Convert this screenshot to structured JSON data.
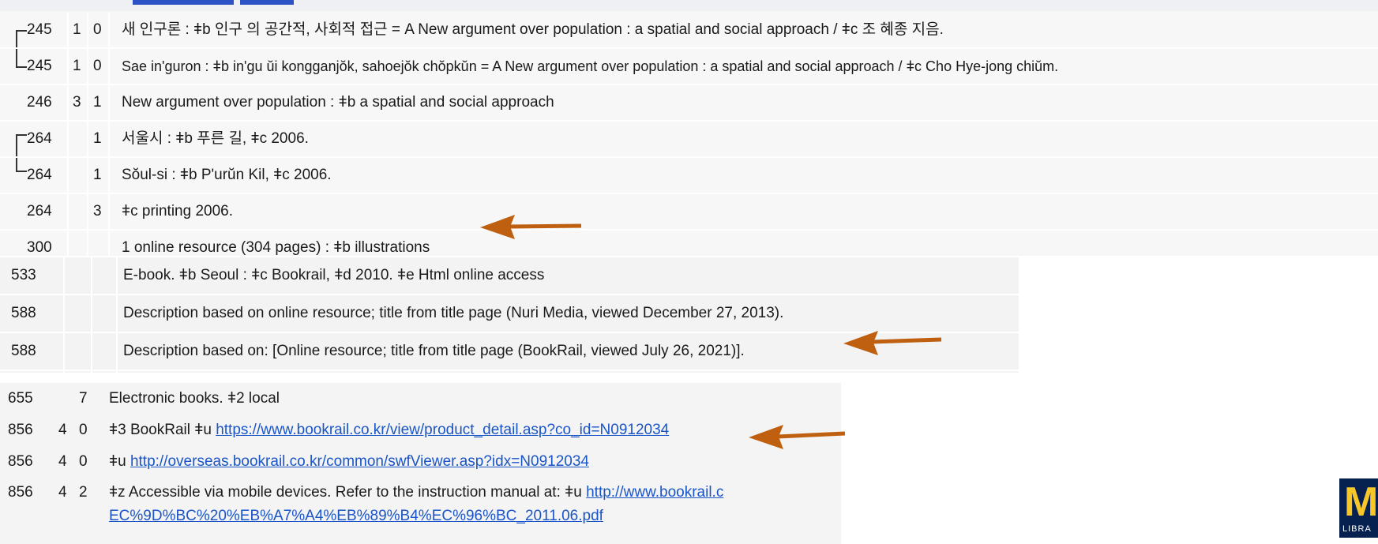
{
  "panel_a": {
    "rows": [
      {
        "tag": "245",
        "ind1": "1",
        "ind2": "0",
        "content": "새 인구론 : ǂb 인구 의 공간적, 사회적 접근 = A New argument over population : a spatial and social approach / ǂc 조 혜종 지음."
      },
      {
        "tag": "245",
        "ind1": "1",
        "ind2": "0",
        "content": "Sae in'guron : ǂb in'gu ŭi kongganjŏk, sahoejŏk chŏpkŭn = A New argument over population : a spatial and social approach / ǂc Cho Hye-jong chiŭm."
      },
      {
        "tag": "246",
        "ind1": "3",
        "ind2": "1",
        "content": "New argument over population : ǂb a spatial and social approach"
      },
      {
        "tag": "264",
        "ind1": "",
        "ind2": "1",
        "content": "서울시 : ǂb 푸른 길, ǂc 2006."
      },
      {
        "tag": "264",
        "ind1": "",
        "ind2": "1",
        "content": "Sŏul-si : ǂb P'urŭn Kil, ǂc 2006."
      },
      {
        "tag": "264",
        "ind1": "",
        "ind2": "3",
        "content": "ǂc printing 2006."
      },
      {
        "tag": "300",
        "ind1": "",
        "ind2": "",
        "content": "1 online resource (304 pages) : ǂb illustrations"
      }
    ]
  },
  "panel_b": {
    "rows": [
      {
        "tag": "533",
        "content": "E-book. ǂb Seoul : ǂc Bookrail, ǂd 2010. ǂe Html online access"
      },
      {
        "tag": "588",
        "content": "Description based on online resource; title from title page (Nuri Media, viewed December 27, 2013)."
      },
      {
        "tag": "588",
        "content": "Description based on: [Online resource; title from title page (BookRail, viewed July 26, 2021)]."
      }
    ]
  },
  "panel_c": {
    "rows": [
      {
        "tag": "655",
        "ind1": "",
        "ind2": "7",
        "prefix": "ǂ2 local",
        "content": "Electronic books."
      },
      {
        "tag": "856",
        "ind1": "4",
        "ind2": "0",
        "prefix": "ǂ3 BookRail ǂu",
        "link": "https://www.bookrail.co.kr/view/product_detail.asp?co_id=N0912034"
      },
      {
        "tag": "856",
        "ind1": "4",
        "ind2": "0",
        "prefix": "ǂu",
        "link": "http://overseas.bookrail.co.kr/common/swfViewer.asp?idx=N0912034"
      },
      {
        "tag": "856",
        "ind1": "4",
        "ind2": "2",
        "prefix": "ǂz Accessible via mobile devices. Refer to the instruction manual at: ǂu",
        "link": "http://www.bookrail.c",
        "link_line2": "EC%9D%BC%20%EB%A7%A4%EB%89%B4%EC%96%BC_2011.06.pdf"
      }
    ]
  },
  "logo": {
    "letter": "M",
    "caption": "LIBRA"
  },
  "colors": {
    "arrow": "#bf5f10",
    "link": "#1a55c8",
    "logo_bg": "#06214f",
    "logo_fg": "#f7c629"
  },
  "icons": [
    "arrow-icon",
    "bracket-icon"
  ]
}
